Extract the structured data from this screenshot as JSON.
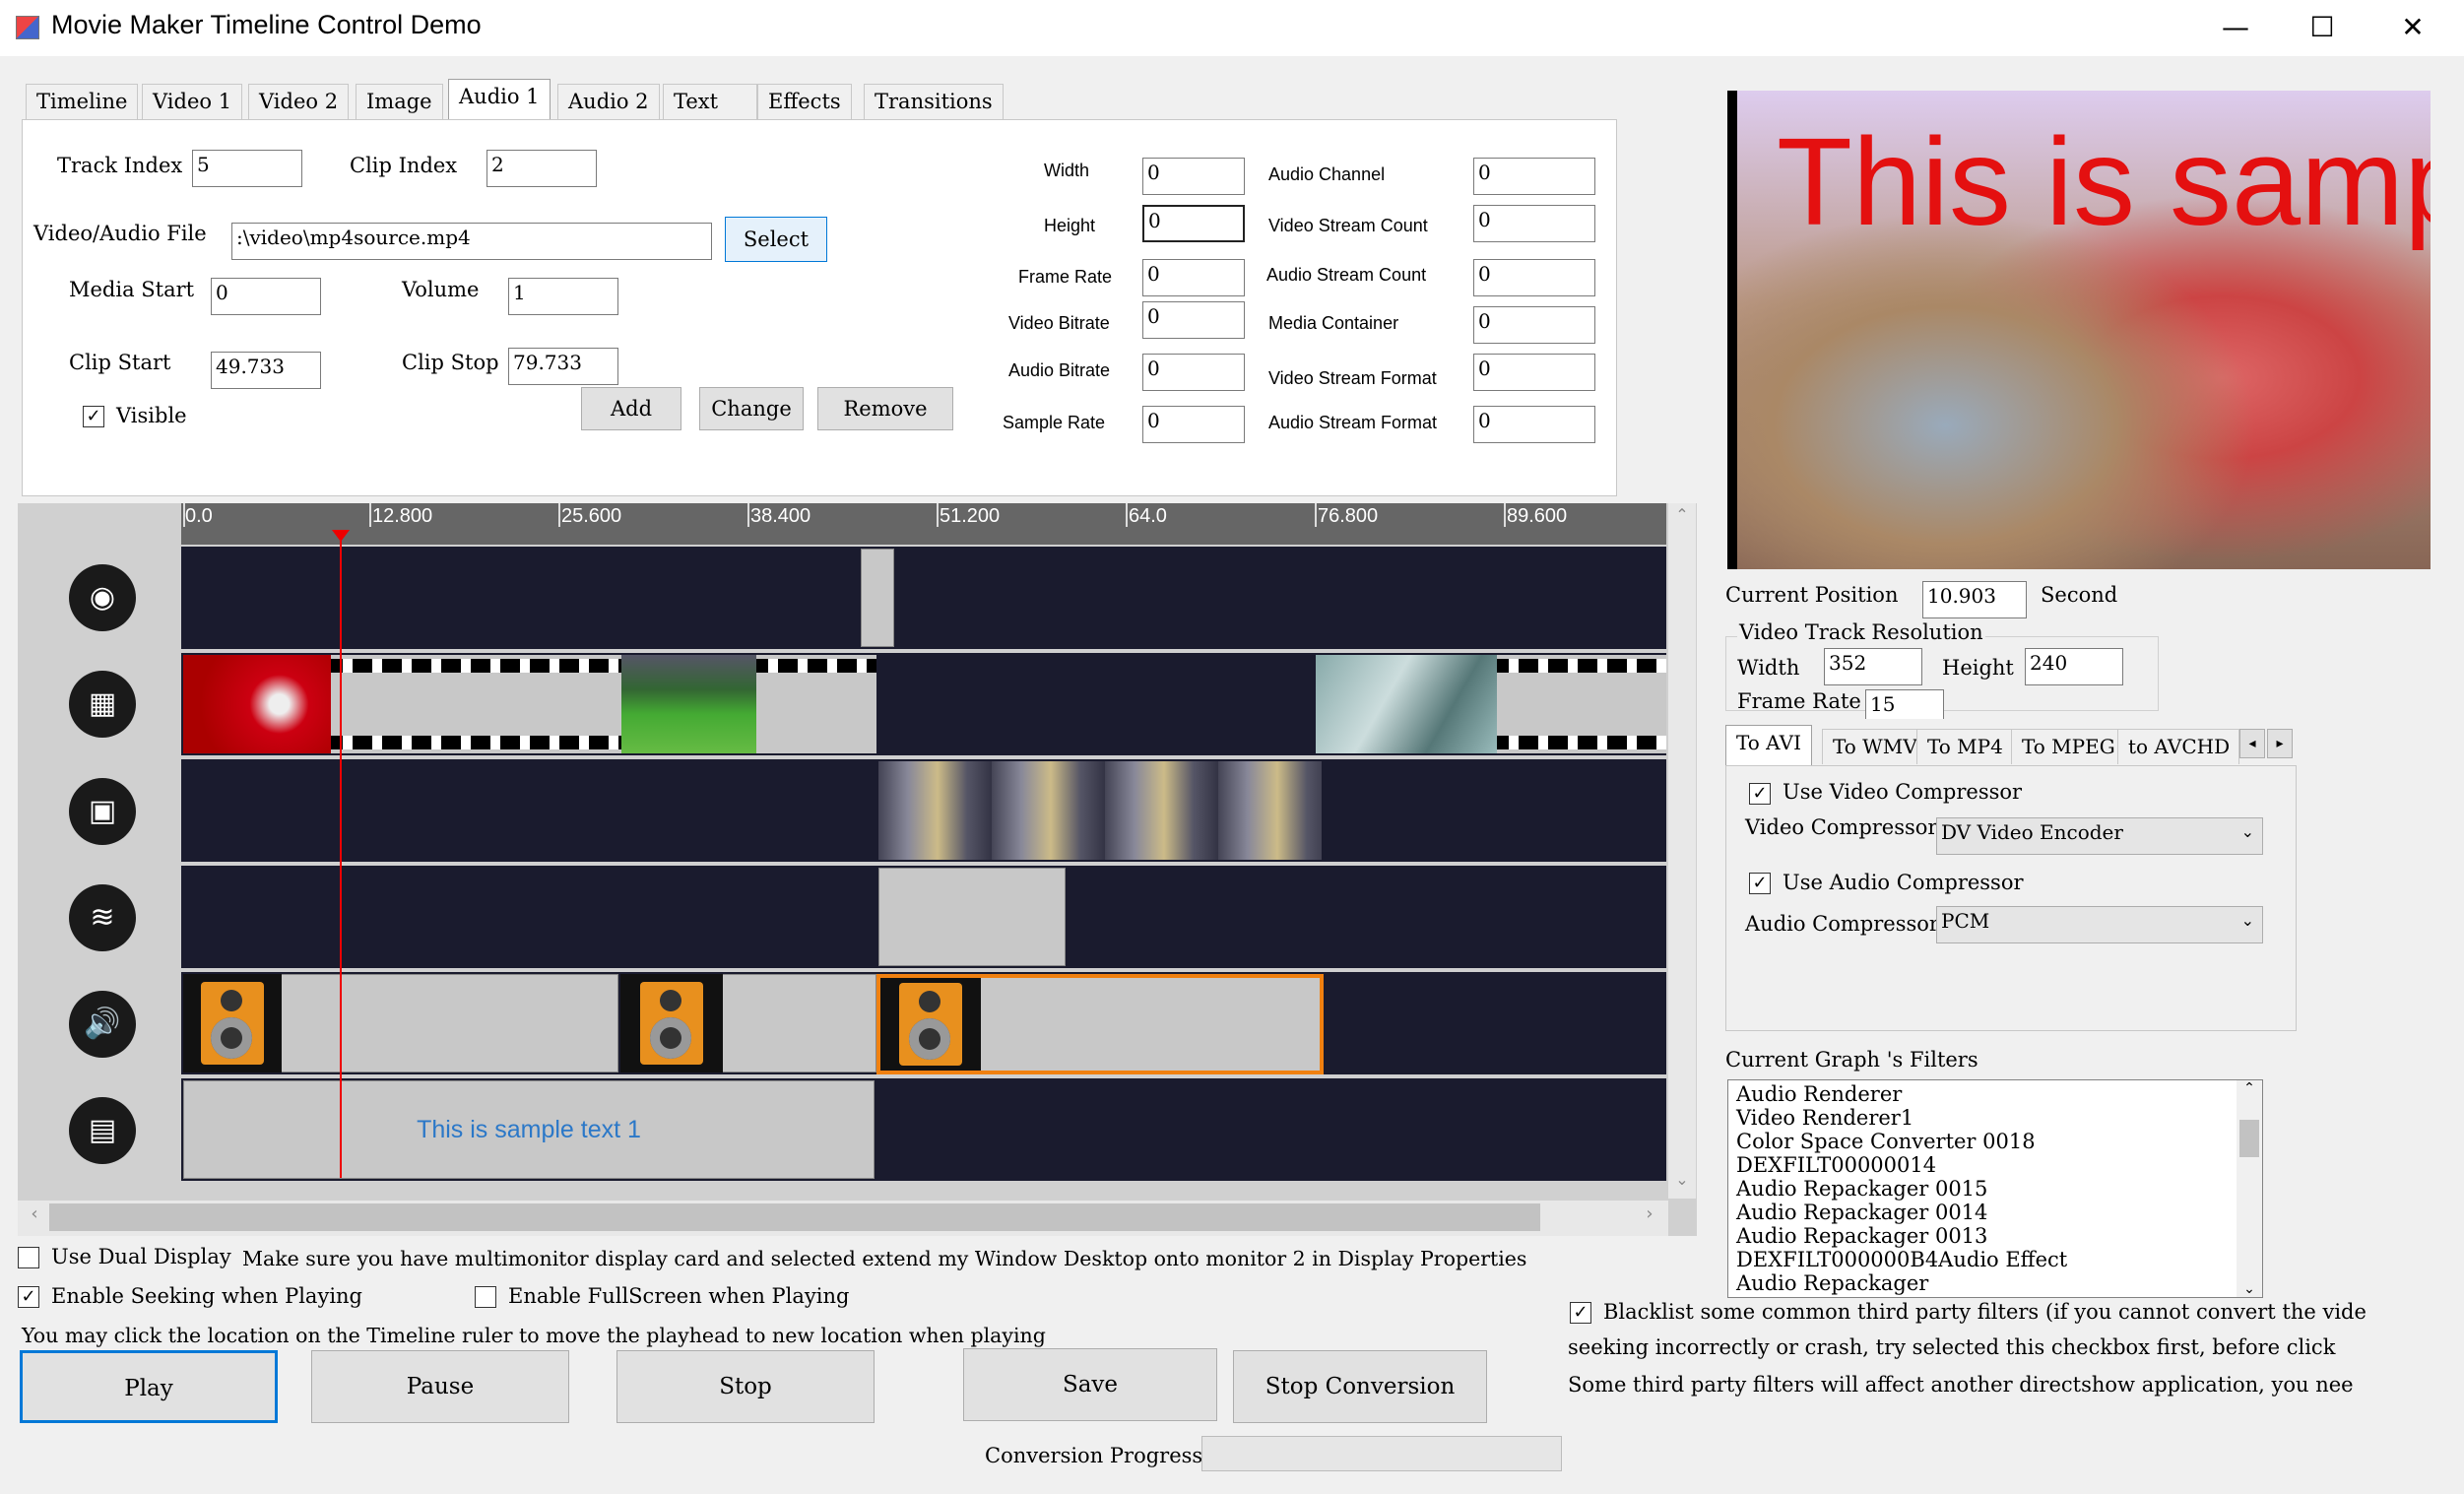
{
  "window": {
    "title": "Movie Maker Timeline Control Demo",
    "minimize": "—",
    "maximize": "☐",
    "close": "✕"
  },
  "tabs": [
    "Timeline",
    "Video 1",
    "Video 2",
    "Image",
    "Audio 1",
    "Audio 2",
    "Text",
    "Effects",
    "Transitions"
  ],
  "form": {
    "track_index_label": "Track Index",
    "track_index": "5",
    "clip_index_label": "Clip Index",
    "clip_index": "2",
    "file_label": "Video/Audio File",
    "file_value": ":\\video\\mp4source.mp4",
    "select": "Select",
    "media_start_label": "Media Start",
    "media_start": "0",
    "volume_label": "Volume",
    "volume": "1",
    "clip_start_label": "Clip Start",
    "clip_start": "49.733",
    "clip_stop_label": "Clip Stop",
    "clip_stop": "79.733",
    "visible_label": "Visible",
    "add": "Add",
    "change": "Change",
    "remove": "Remove"
  },
  "props_left": [
    {
      "label": "Width",
      "value": "0"
    },
    {
      "label": "Height",
      "value": "0"
    },
    {
      "label": "Frame Rate",
      "value": "0"
    },
    {
      "label": "Video Bitrate",
      "value": "0"
    },
    {
      "label": "Audio Bitrate",
      "value": "0"
    },
    {
      "label": "Sample Rate",
      "value": "0"
    }
  ],
  "props_right": [
    {
      "label": "Audio Channel",
      "value": "0"
    },
    {
      "label": "Video Stream Count",
      "value": "0"
    },
    {
      "label": "Audio Stream Count",
      "value": "0"
    },
    {
      "label": "Media Container",
      "value": "0"
    },
    {
      "label": "Video Stream Format",
      "value": "0"
    },
    {
      "label": "Audio Stream Format",
      "value": "0"
    }
  ],
  "ruler": [
    "0.0",
    "12.800",
    "25.600",
    "38.400",
    "51.200",
    "64.0",
    "76.800",
    "89.600"
  ],
  "timeline": {
    "playhead_seconds": 10.903,
    "text_clip": "This is sample text 1"
  },
  "preview": {
    "overlay_text": "This is sample"
  },
  "position": {
    "label": "Current Position",
    "value": "10.903",
    "unit": "Second"
  },
  "resolution": {
    "group": "Video Track Resolution",
    "width_label": "Width",
    "width": "352",
    "height_label": "Height",
    "height": "240",
    "fps_label": "Frame Rate",
    "fps": "15"
  },
  "convert_tabs": [
    "To AVI",
    "To WMV",
    "To MP4",
    "To MPEG",
    "to AVCHD"
  ],
  "compress": {
    "use_video": "Use Video Compressor",
    "video_label": "Video Compressor",
    "video_value": "DV Video Encoder",
    "use_audio": "Use Audio Compressor",
    "audio_label": "Audio Compressor",
    "audio_value": "PCM"
  },
  "filters": {
    "label": "Current Graph 's Filters",
    "items": [
      "Audio Renderer",
      "Video Renderer1",
      "Color Space Converter 0018",
      "DEXFILT00000014",
      "Audio Repackager 0015",
      "Audio Repackager 0014",
      "Audio Repackager 0013",
      "DEXFILT000000B4Audio Effect",
      "Audio Repackager"
    ]
  },
  "options": {
    "dual_display": "Use Dual Display",
    "dual_note": "Make sure you have multimonitor display card and selected extend my Window Desktop onto monitor 2 in Display Properties",
    "seeking": "Enable Seeking when Playing",
    "fullscreen": "Enable FullScreen when Playing",
    "hint": "You may click the location on the Timeline ruler to move the playhead to new location when playing",
    "blacklist_1": "Blacklist some common third party filters (if you cannot convert the vide",
    "blacklist_2": "seeking incorrectly or crash, try selected this checkbox first, before click",
    "blacklist_3": "Some third party filters will affect another directshow application, you nee"
  },
  "buttons": {
    "play": "Play",
    "pause": "Pause",
    "stop": "Stop",
    "save": "Save",
    "stop_conversion": "Stop Conversion"
  },
  "progress": {
    "label": "Conversion Progress",
    "value": 0
  }
}
